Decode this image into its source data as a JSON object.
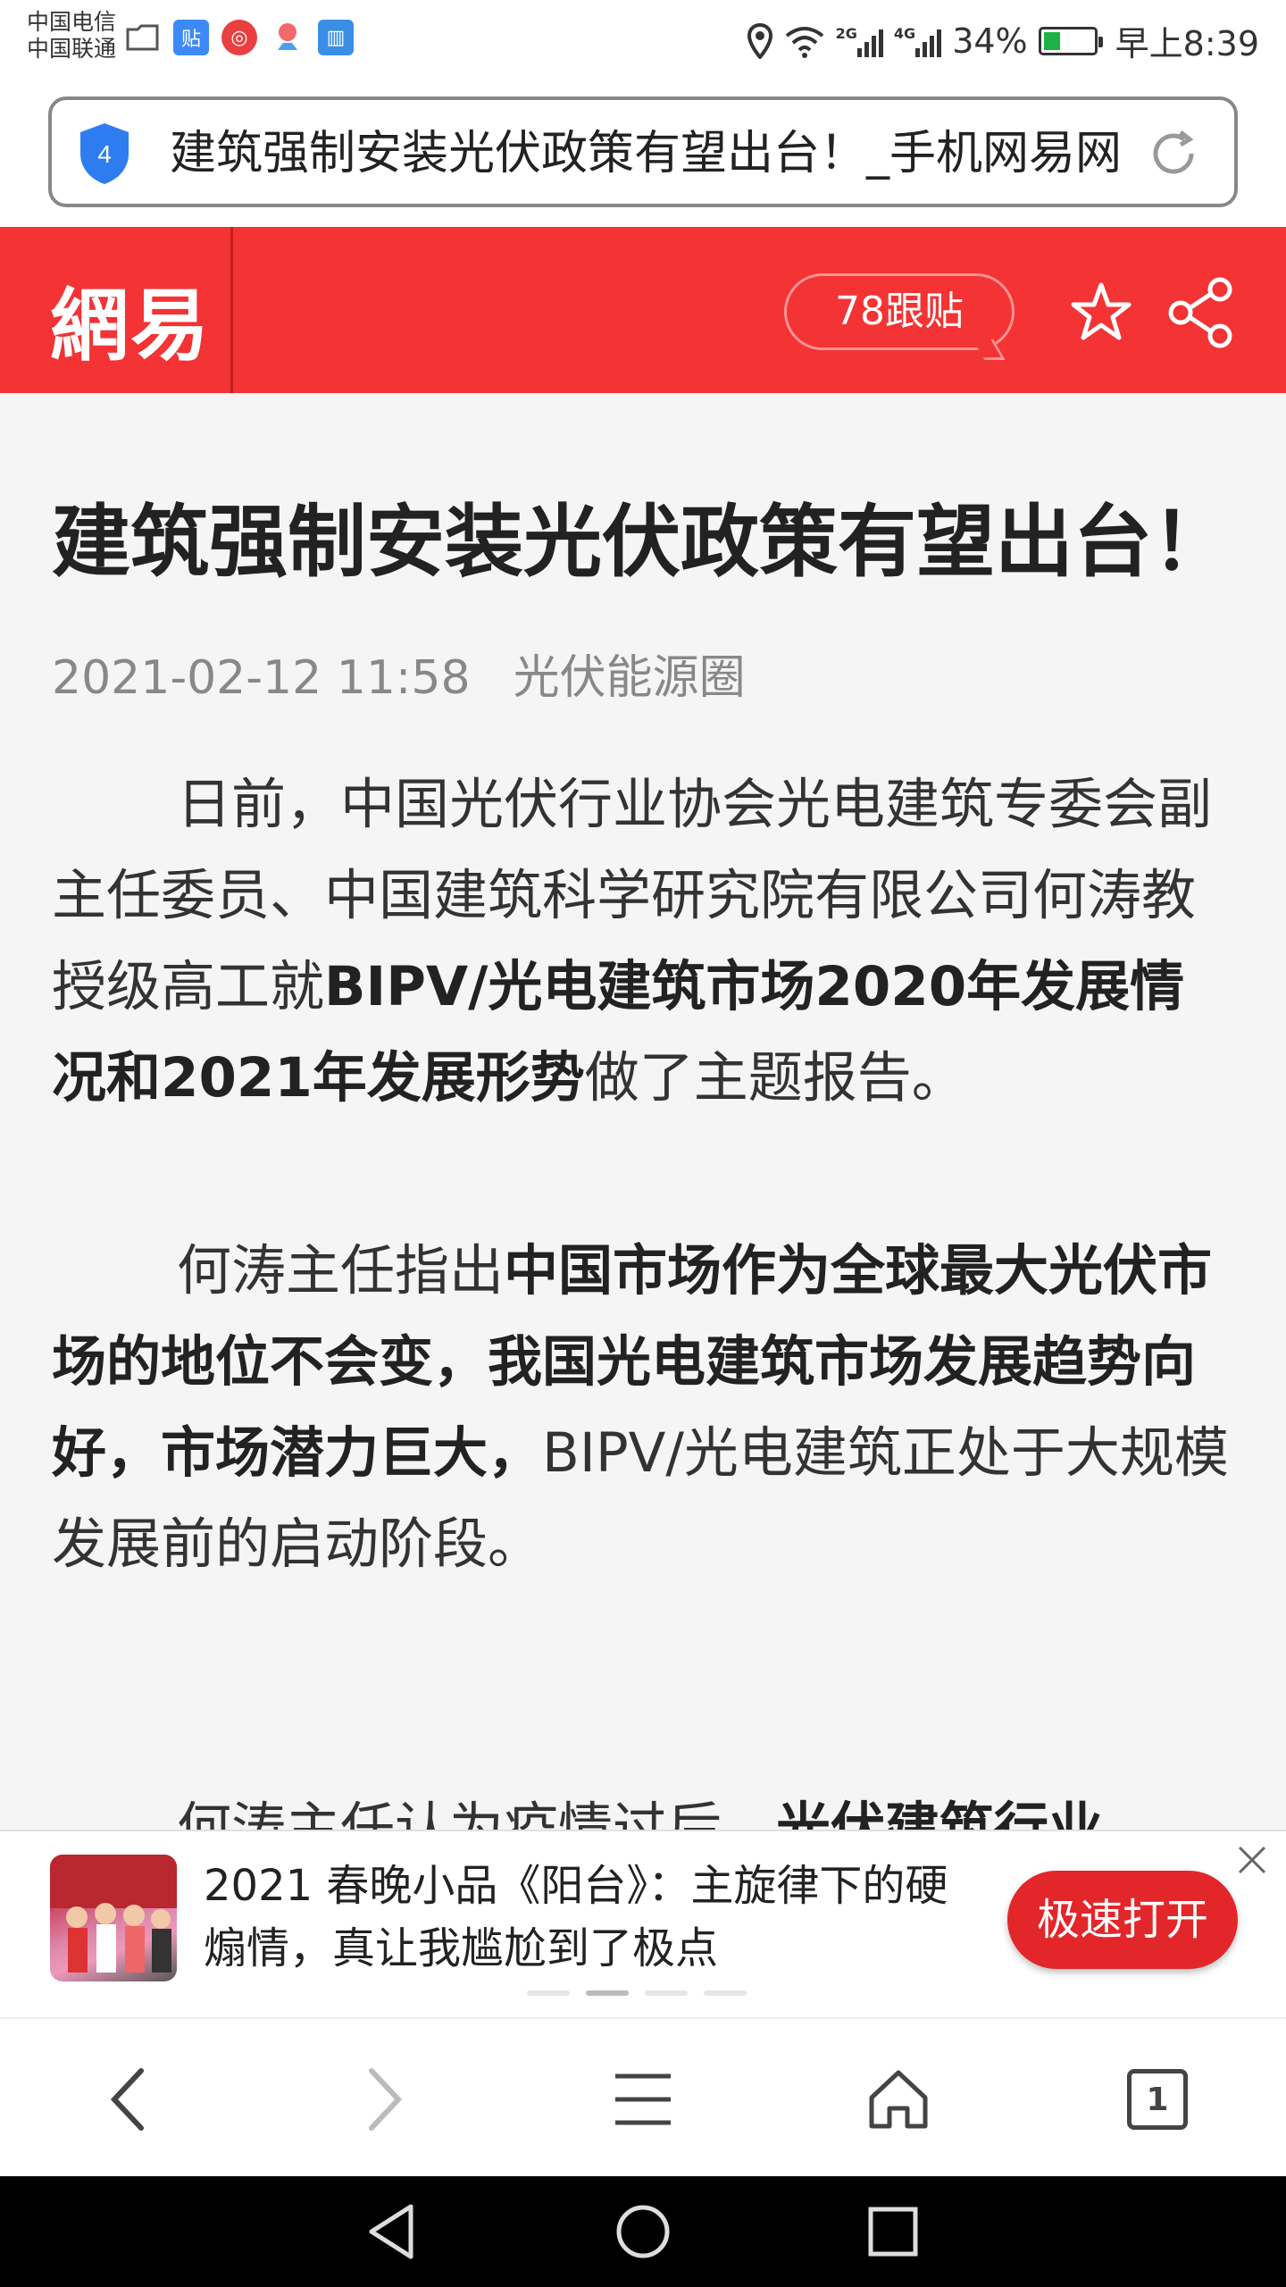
{
  "status_bar": {
    "carrier_1": "中国电信",
    "carrier_2": "中国联通",
    "net_2g": "2G",
    "net_4g": "4G",
    "battery": "34%",
    "time": "早上8:39",
    "notif_icons": [
      "folder-icon",
      "tieba-icon",
      "bank-icon",
      "map-icon",
      "reader-icon"
    ]
  },
  "address_bar": {
    "tab_count": "4",
    "title": "建筑强制安装光伏政策有望出台！_手机网易网"
  },
  "header": {
    "logo": "網易",
    "comments": "78跟贴",
    "accent": "#f33334"
  },
  "article": {
    "title": "建筑强制安装光伏政策有望出台！",
    "date": "2021-02-12 11:58",
    "source": "光伏能源圈",
    "p1_a": "日前，中国光伏行业协会光电建筑专委会副主任委员、中国建筑科学研究院有限公司何涛教授级高工就",
    "p1_b": "BIPV/光电建筑市场2020年发展情况和2021年发展形势",
    "p1_c": "做了主题报告。",
    "p2_a": "何涛主任指出",
    "p2_b": "中国市场作为全球最大光伏市场的地位不会变，我国光电建筑市场发展趋势向好，市场潜力巨大，",
    "p2_c": "BIPV/光电建筑正处于大规模发展前的启动阶段。",
    "p3_a": "何涛主任认为疫情过后，",
    "p3_b": "光伏建筑行业"
  },
  "ad": {
    "text": "2021 春晚小品《阳台》：主旋律下的硬煽情，真让我尴尬到了极点",
    "button": "极速打开"
  },
  "toolbar": {
    "tabs_count": "1"
  }
}
